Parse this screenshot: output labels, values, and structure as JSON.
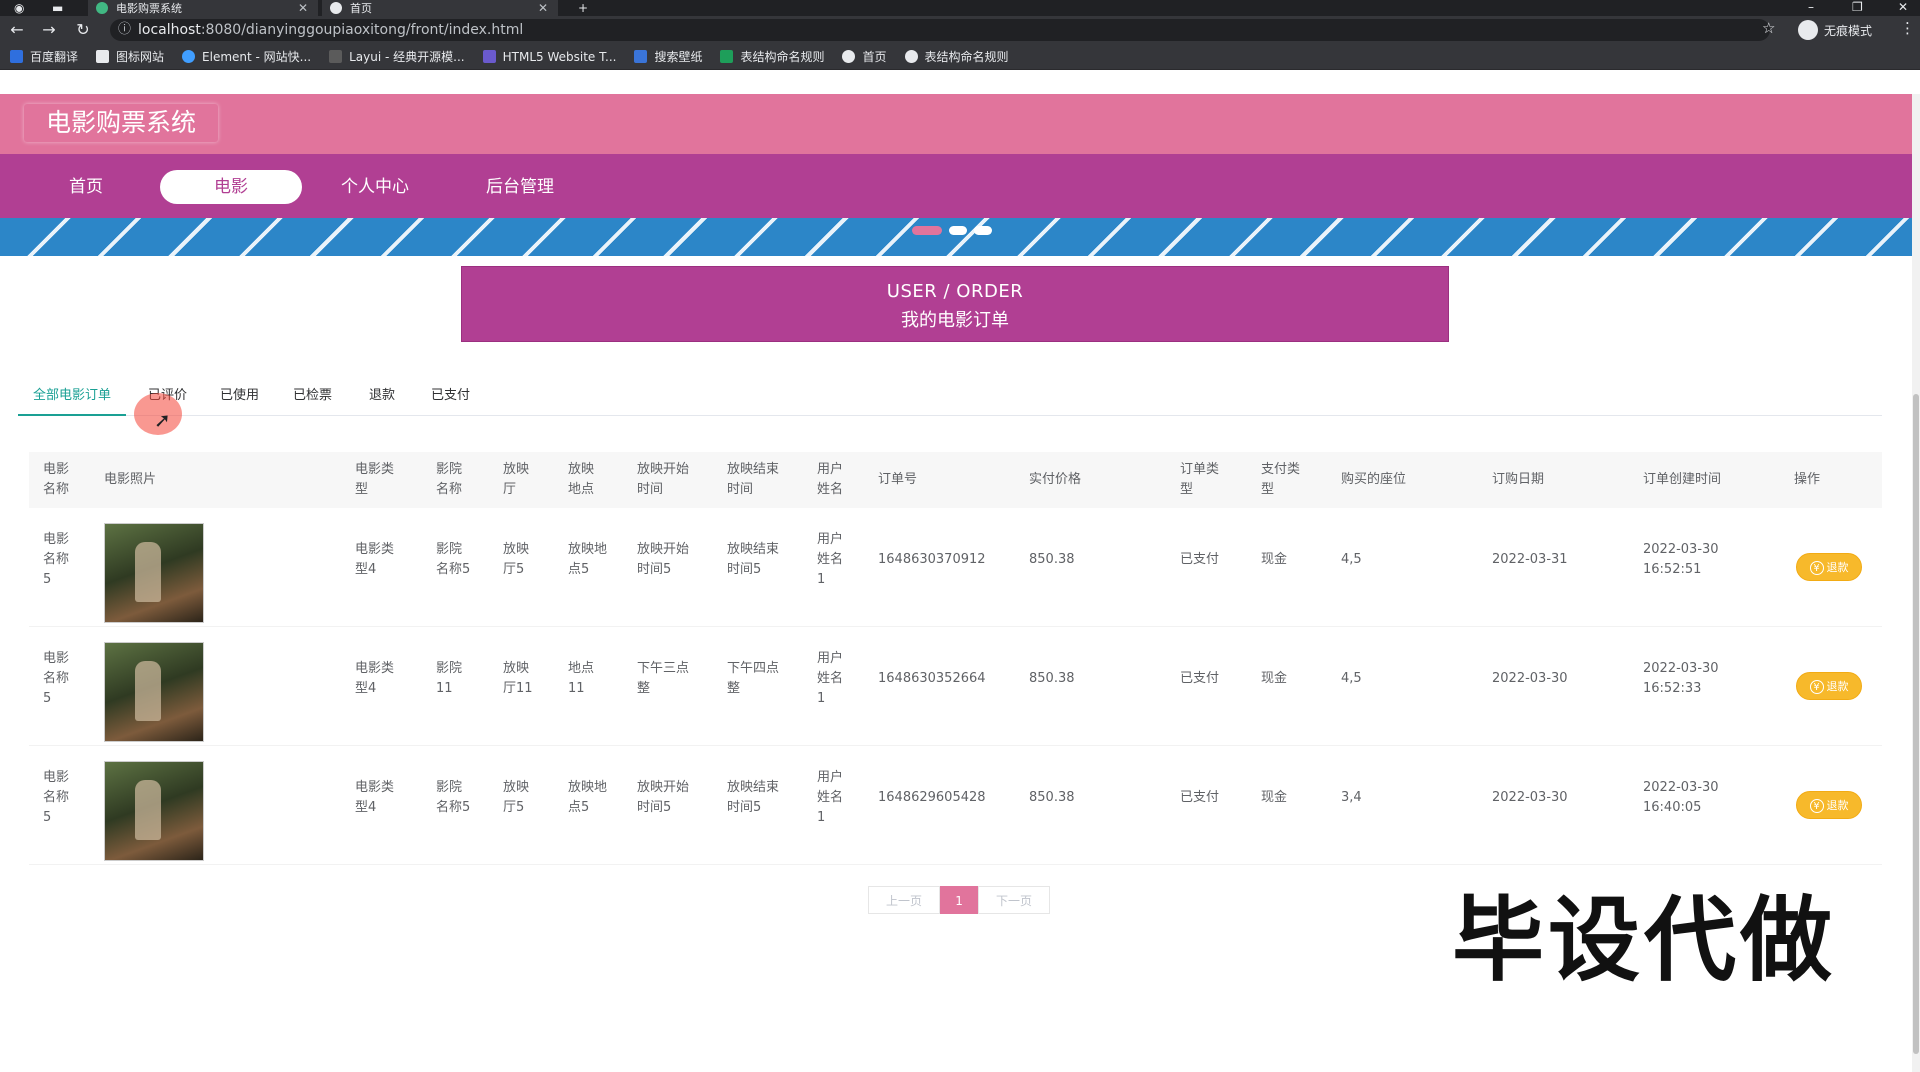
{
  "browser": {
    "tabs": [
      {
        "title": "电影购票系统",
        "active": false
      },
      {
        "title": "首页",
        "active": true
      }
    ],
    "url_host": "localhost",
    "url_rest": ":8080/dianyinggoupiaoxitong/front/index.html",
    "profile_label": "无痕模式",
    "bookmarks": [
      "百度翻译",
      "图标网站",
      "Element - 网站快...",
      "Layui - 经典开源模...",
      "HTML5 Website T...",
      "搜索壁纸",
      "表结构命名规则",
      "首页",
      "表结构命名规则"
    ]
  },
  "site": {
    "title": "电影购票系统",
    "nav": [
      "首页",
      "电影",
      "个人中心",
      "后台管理"
    ],
    "active_nav": "电影"
  },
  "heading": {
    "en": "USER / ORDER",
    "zh": "我的电影订单"
  },
  "tabs": [
    "全部电影订单",
    "已评价",
    "已使用",
    "已检票",
    "退款",
    "已支付"
  ],
  "table": {
    "headers": [
      "电影名称",
      "电影照片",
      "电影类型",
      "影院名称",
      "放映厅",
      "放映地点",
      "放映开始时间",
      "放映结束时间",
      "用户姓名",
      "订单号",
      "实付价格",
      "订单类型",
      "支付类型",
      "购买的座位",
      "订购日期",
      "订单创建时间",
      "操作"
    ],
    "rows": [
      {
        "movie": "电影名称5",
        "type": "电影类型4",
        "cinema": "影院名称5",
        "hall": "放映厅5",
        "place": "放映地点5",
        "start": "放映开始时间5",
        "end": "放映结束时间5",
        "user": "用户姓名1",
        "order_no": "1648630370912",
        "price": "850.38",
        "order_type": "已支付",
        "pay_type": "现金",
        "seat": "4,5",
        "date": "2022-03-31",
        "created": "2022-03-30 16:52:51",
        "action": "退款"
      },
      {
        "movie": "电影名称5",
        "type": "电影类型4",
        "cinema": "影院11",
        "hall": "放映厅11",
        "place": "地点11",
        "start": "下午三点整",
        "end": "下午四点整",
        "user": "用户姓名1",
        "order_no": "1648630352664",
        "price": "850.38",
        "order_type": "已支付",
        "pay_type": "现金",
        "seat": "4,5",
        "date": "2022-03-30",
        "created": "2022-03-30 16:52:33",
        "action": "退款"
      },
      {
        "movie": "电影名称5",
        "type": "电影类型4",
        "cinema": "影院名称5",
        "hall": "放映厅5",
        "place": "放映地点5",
        "start": "放映开始时间5",
        "end": "放映结束时间5",
        "user": "用户姓名1",
        "order_no": "1648629605428",
        "price": "850.38",
        "order_type": "已支付",
        "pay_type": "现金",
        "seat": "3,4",
        "date": "2022-03-30",
        "created": "2022-03-30 16:40:05",
        "action": "退款"
      }
    ]
  },
  "pagination": {
    "prev": "上一页",
    "current": "1",
    "next": "下一页"
  },
  "watermark": "毕设代做",
  "colors": {
    "header": "#e1749c",
    "nav": "#b13f93",
    "accent_tab": "#1aa094",
    "refund_button": "#f7b92b"
  }
}
